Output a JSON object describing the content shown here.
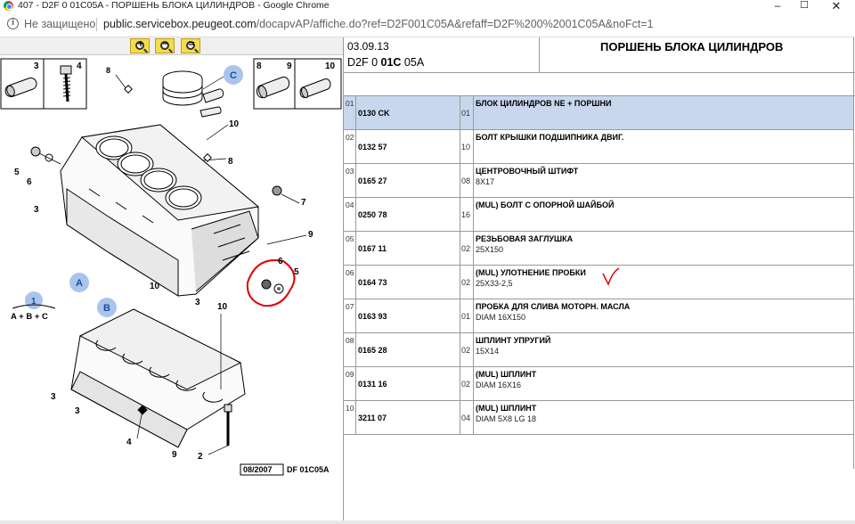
{
  "window": {
    "title": "407 - D2F 0 01C05A - ПОРШЕНЬ БЛОКА ЦИЛИНДРОВ - Google Chrome",
    "controls": {
      "minimize": "–",
      "maximize": "☐",
      "close": "✕"
    }
  },
  "addressbar": {
    "security": "Не защищено",
    "host": "public.servicebox.peugeot.com",
    "path": "/docapvAP/affiche.do?ref=D2F001C05A&refaff=D2F%200%2001C05A&noFct=1"
  },
  "toolbar": {
    "zoom_in": "+",
    "zoom_out": "−",
    "fit": "="
  },
  "diagram": {
    "labels": {
      "part_3": "3",
      "part_4": "4",
      "part_8": "8",
      "part_9": "9",
      "part_10": "10",
      "part_5": "5",
      "part_6": "6",
      "part_7": "7",
      "part_2": "2",
      "group_a": "A",
      "group_b": "B",
      "group_c": "C",
      "group_1": "1",
      "group_formula": "A + B + C"
    },
    "date_code": "08/2007",
    "ref_code": "DF 01C05A"
  },
  "header": {
    "date": "03.09.13",
    "code_prefix": "D2F 0 ",
    "code_bold": "01C",
    "code_suffix": " 05A",
    "title": "ПОРШЕНЬ БЛОКА ЦИЛИНДРОВ"
  },
  "parts": [
    {
      "num": "01",
      "ref": "0130 CK",
      "qty": "01",
      "desc": "БЛОК ЦИЛИНДРОВ NE + ПОРШНИ",
      "detail": ""
    },
    {
      "num": "02",
      "ref": "0132 57",
      "qty": "10",
      "desc": "БОЛТ КРЫШКИ ПОДШИПНИКА ДВИГ.",
      "detail": ""
    },
    {
      "num": "03",
      "ref": "0165 27",
      "qty": "08",
      "desc": "ЦЕНТРОВОЧНЫЙ ШТИФТ",
      "detail": "8X17"
    },
    {
      "num": "04",
      "ref": "0250 78",
      "qty": "16",
      "desc": "(MUL) БОЛТ С ОПОРНОЙ ШАЙБОЙ",
      "detail": ""
    },
    {
      "num": "05",
      "ref": "0167 11",
      "qty": "02",
      "desc": "РЕЗЬБОВАЯ ЗАГЛУШКА",
      "detail": "25X150"
    },
    {
      "num": "06",
      "ref": "0164 73",
      "qty": "02",
      "desc": "(MUL) УЛОТНЕНИЕ ПРОБКИ",
      "detail": "25X33-2,5"
    },
    {
      "num": "07",
      "ref": "0163 93",
      "qty": "01",
      "desc": "ПРОБКА ДЛЯ СЛИВА МОТОРН. МАСЛА",
      "detail": "DIAM 16X150"
    },
    {
      "num": "08",
      "ref": "0165 28",
      "qty": "02",
      "desc": "ШПЛИНТ УПРУГИЙ",
      "detail": "15X14"
    },
    {
      "num": "09",
      "ref": "0131 16",
      "qty": "02",
      "desc": "(MUL) ШПЛИНТ",
      "detail": "DIAM 16X16"
    },
    {
      "num": "10",
      "ref": "3211 07",
      "qty": "04",
      "desc": "(MUL) ШПЛИНТ",
      "detail": "DIAM 5X8 LG 18"
    }
  ],
  "selected_row": 0,
  "colors": {
    "selected": "#c9d7ee",
    "marker": "#e00000",
    "group_badge": "#aac4ec"
  }
}
